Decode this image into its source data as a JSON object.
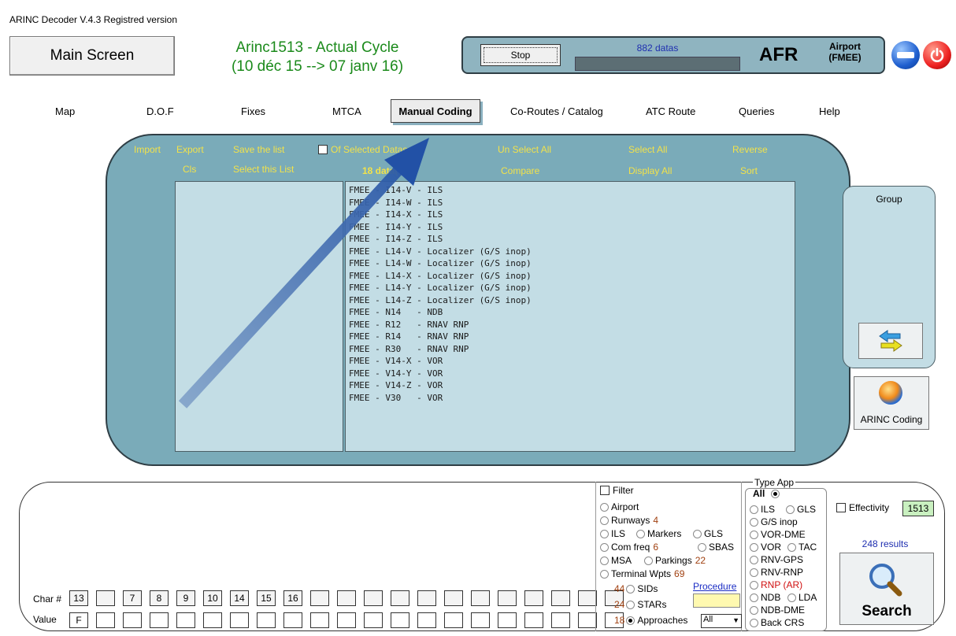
{
  "app": {
    "title": "ARINC Decoder V.4.3  Registred version"
  },
  "header": {
    "main_screen_label": "Main Screen",
    "cycle_line1": "Arinc1513 - Actual Cycle",
    "cycle_line2": "(10 déc 15 --> 07 janv 16)",
    "stop_label": "Stop",
    "datas_count": "882 datas",
    "progress": 0.0,
    "airline_code": "AFR",
    "airport_label": "Airport",
    "airport_code": "(FMEE)",
    "minimize_icon": "minimize-icon",
    "power_icon": "power-icon"
  },
  "menu": {
    "map": "Map",
    "dof": "D.O.F",
    "fixes": "Fixes",
    "mtca": "MTCA",
    "manual_coding": "Manual Coding",
    "co_routes": "Co-Routes / Catalog",
    "atc_route": "ATC Route",
    "queries": "Queries",
    "help": "Help"
  },
  "list_panel": {
    "import": "Import",
    "export": "Export",
    "save_list": "Save the list",
    "of_selected": "Of Selected Datas",
    "unselect_all": "Un Select All",
    "select_all": "Select All",
    "reverse": "Reverse",
    "cls": "Cls",
    "select_this_list": "Select this List",
    "data_count": "18 data(s)",
    "compare": "Compare",
    "display_all": "Display All",
    "sort": "Sort",
    "rows": [
      "FMEE - I14-V - ILS",
      "FMEE - I14-W - ILS",
      "FMEE - I14-X - ILS",
      "FMEE - I14-Y - ILS",
      "FMEE - I14-Z - ILS",
      "FMEE - L14-V - Localizer (G/S inop)",
      "FMEE - L14-W - Localizer (G/S inop)",
      "FMEE - L14-X - Localizer (G/S inop)",
      "FMEE - L14-Y - Localizer (G/S inop)",
      "FMEE - L14-Z - Localizer (G/S inop)",
      "FMEE - N14   - NDB",
      "FMEE - R12   - RNAV RNP",
      "FMEE - R14   - RNAV RNP",
      "FMEE - R30   - RNAV RNP",
      "FMEE - V14-X - VOR",
      "FMEE - V14-Y - VOR",
      "FMEE - V14-Z - VOR",
      "FMEE - V30   - VOR"
    ]
  },
  "group": {
    "label": "Group",
    "transfer_icon": "transfer-arrows-icon",
    "arinc_coding_label": "ARINC Coding"
  },
  "grid": {
    "char_label": "Char #",
    "value_label": "Value",
    "char_cells": [
      "13",
      "",
      "7",
      "8",
      "9",
      "10",
      "14",
      "15",
      "16",
      "",
      "",
      "",
      "",
      "",
      "",
      "",
      "",
      "",
      "",
      "",
      ""
    ],
    "value_cells": [
      "F",
      "",
      "",
      "",
      "",
      "",
      "",
      "",
      "",
      "",
      "",
      "",
      "",
      "",
      "",
      "",
      "",
      "",
      "",
      "",
      ""
    ]
  },
  "filter": {
    "filter_label": "Filter",
    "airport": "Airport",
    "runways": "Runways",
    "runways_count": "4",
    "ils": "ILS",
    "markers": "Markers",
    "gls": "GLS",
    "com_freq": "Com freq",
    "com_freq_count": "6",
    "sbas": "SBAS",
    "msa": "MSA",
    "parkings": "Parkings",
    "parkings_count": "22",
    "terminal_wpts": "Terminal Wpts",
    "terminal_wpts_count": "69",
    "sids_count": "44",
    "sids": "SIDs",
    "stars_count": "24",
    "stars": "STARs",
    "approaches_count": "18",
    "approaches": "Approaches",
    "procedure_link": "Procedure",
    "approach_select": "All"
  },
  "type_app": {
    "title": "Type App",
    "all": "All",
    "ils": "ILS",
    "gls": "GLS",
    "gs_inop": "G/S inop",
    "vor_dme": "VOR-DME",
    "vor": "VOR",
    "tac": "TAC",
    "rnv_gps": "RNV-GPS",
    "rnv_rnp": "RNV-RNP",
    "rnp_ar": "RNP (AR)",
    "ndb": "NDB",
    "lda": "LDA",
    "ndb_dme": "NDB-DME",
    "back_crs": "Back CRS",
    "rnp_ar_color": "#d01010"
  },
  "search": {
    "effectivity_label": "Effectivity",
    "effectivity_value": "1513",
    "results": "248 results",
    "search_label": "Search",
    "search_icon": "search-icon"
  },
  "colors": {
    "panel": "#7aabb9",
    "list_bg": "#c3dde5",
    "accent_yellow": "#f2e24a",
    "cycle_green": "#1b8a1b",
    "arrow": "#2a5aa8"
  }
}
